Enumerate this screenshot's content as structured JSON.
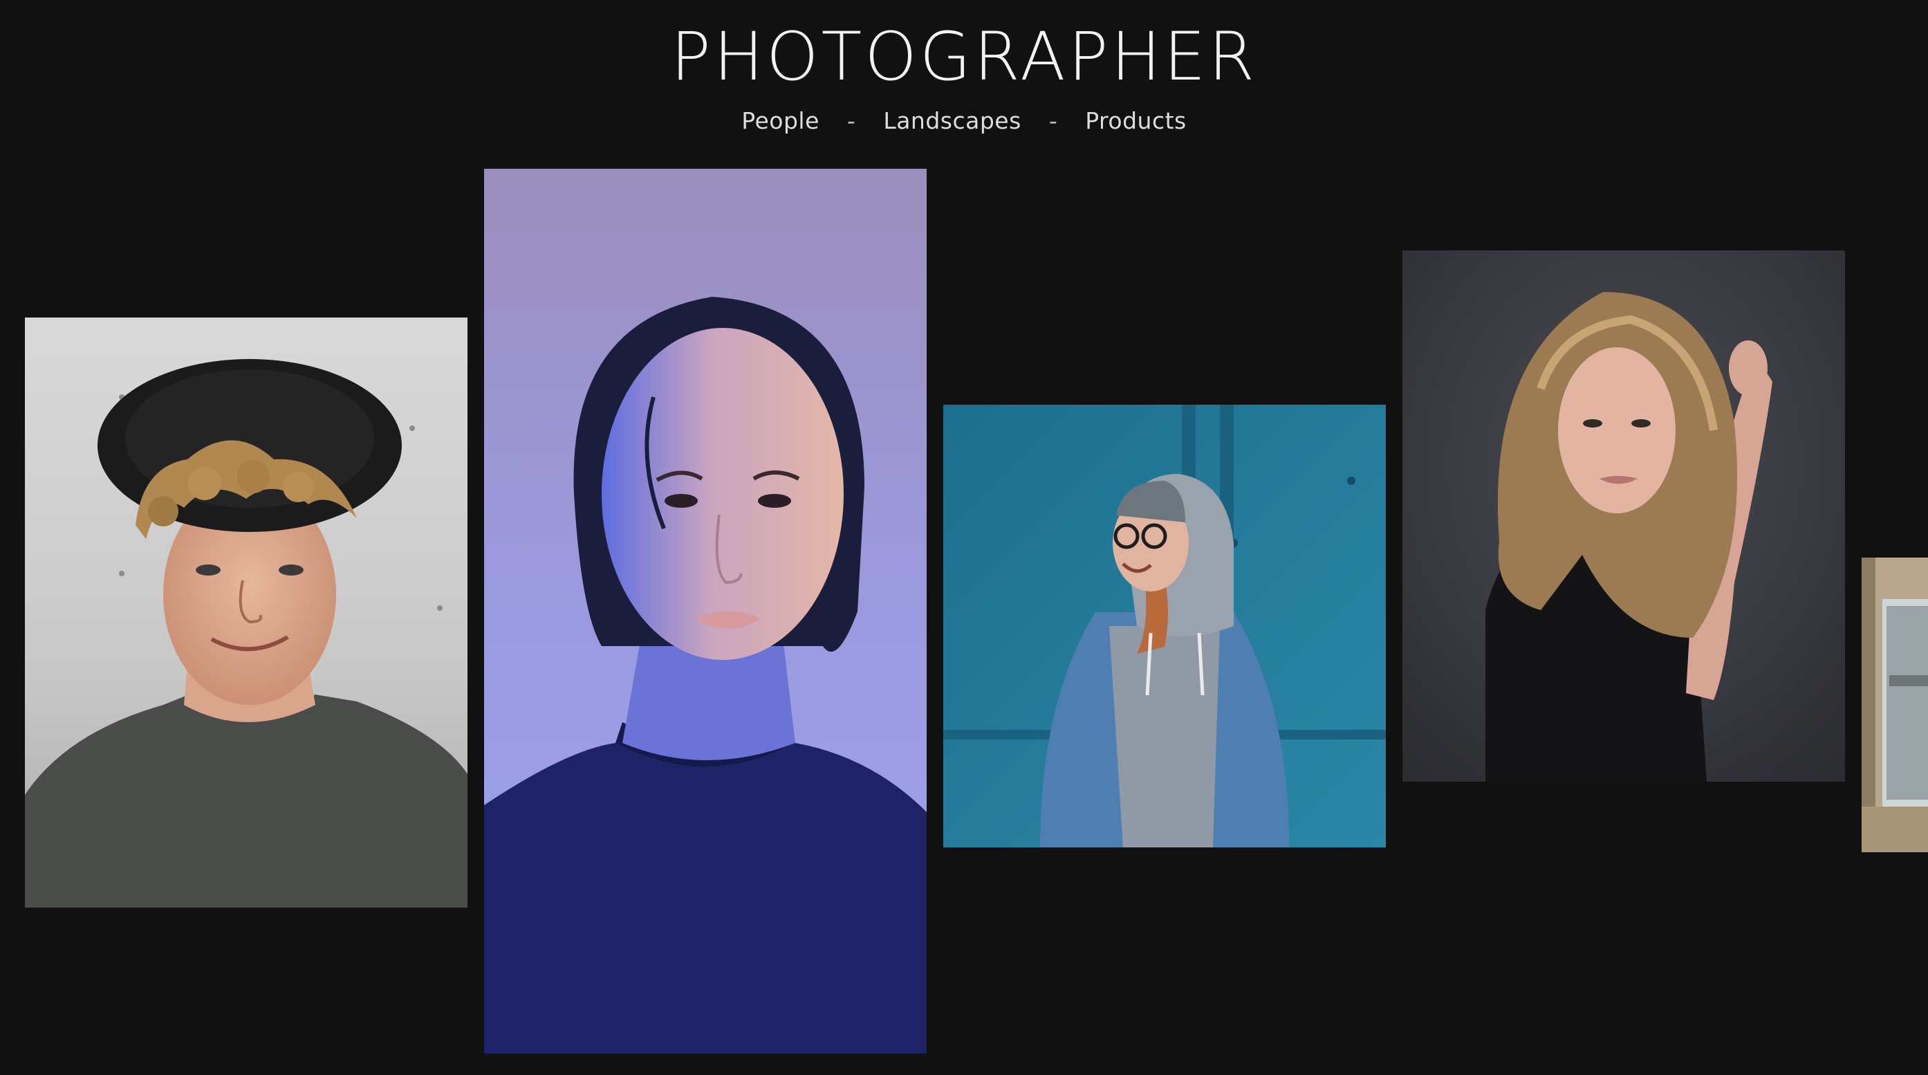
{
  "header": {
    "title": "PHOTOGRAPHER"
  },
  "nav": {
    "items": [
      {
        "label": "People"
      },
      {
        "label": "Landscapes"
      },
      {
        "label": "Products"
      }
    ],
    "separator": "-"
  },
  "gallery": {
    "photos": [
      {
        "subject": "young man with curly blond hair wearing black hat and grey t-shirt against light grey wall"
      },
      {
        "subject": "woman with slicked-back dark hair in blue and purple light wearing navy sweater"
      },
      {
        "subject": "smiling girl in grey hoodie, glasses and denim jacket against teal door"
      },
      {
        "subject": "woman with long wavy blonde hair in black sheer top against dark grey backdrop"
      },
      {
        "subject": "partially visible interior with beige wall and window"
      }
    ]
  },
  "colors": {
    "background": "#111111",
    "title": "#f2f2f2",
    "nav_text": "#dedede"
  }
}
